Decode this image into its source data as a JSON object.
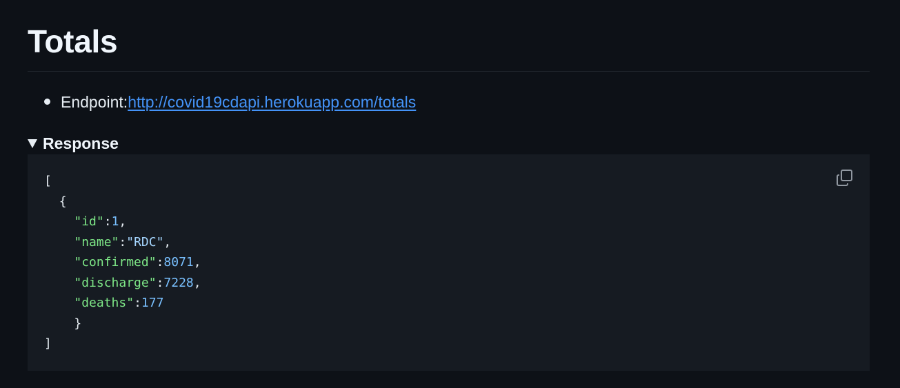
{
  "section": {
    "title": "Totals"
  },
  "endpoint": {
    "label": "Endpoint:",
    "url": "http://covid19cdapi.herokuapp.com/totals"
  },
  "details": {
    "summary": "Response",
    "expanded": true
  },
  "code": {
    "open_bracket": "[",
    "open_brace": "{",
    "fields": [
      {
        "key": "\"id\"",
        "value": "1",
        "type": "number",
        "trailing": ","
      },
      {
        "key": "\"name\"",
        "value": "\"RDC\"",
        "type": "string",
        "trailing": ","
      },
      {
        "key": "\"confirmed\"",
        "value": "8071",
        "type": "number",
        "trailing": ","
      },
      {
        "key": "\"discharge\"",
        "value": "7228",
        "type": "number",
        "trailing": ","
      },
      {
        "key": "\"deaths\"",
        "value": "177",
        "type": "number",
        "trailing": ""
      }
    ],
    "close_brace": "}",
    "close_bracket": "]"
  },
  "icons": {
    "copy": "copy-icon",
    "disclosure": "triangle-down-icon"
  },
  "colors": {
    "background": "#0d1117",
    "code_background": "#161b22",
    "link": "#4493f8",
    "json_key": "#7ee787",
    "json_number": "#79c0ff",
    "json_string": "#a5d6ff"
  }
}
